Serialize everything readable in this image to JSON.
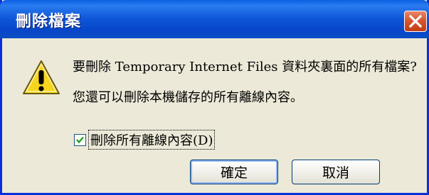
{
  "dialog": {
    "title": "刪除檔案",
    "message_line1": "要刪除 Temporary Internet Files 資料夾裏面的所有檔案?",
    "message_line2": "您還可以刪除本機儲存的所有離線內容。",
    "checkbox_label": "刪除所有離線內容(D)",
    "checkbox_checked": true,
    "ok_label": "確定",
    "cancel_label": "取消",
    "close_icon": "close-icon",
    "warning_icon": "warning-icon"
  },
  "colors": {
    "titlebar": "#0e55d6",
    "window_bg": "#ece9d8",
    "close_button": "#d8582f",
    "checkmark": "#21a121",
    "warning_fill": "#f6d51d"
  }
}
